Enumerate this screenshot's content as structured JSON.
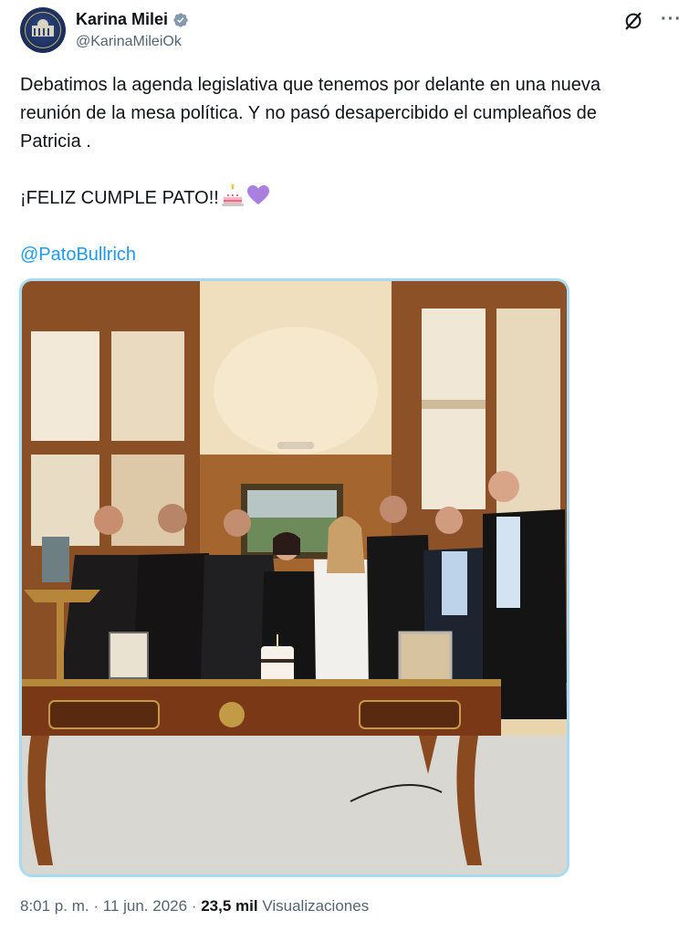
{
  "author": {
    "display_name": "Karina Milei",
    "handle": "@KarinaMileiOk",
    "verified": true,
    "avatar_icon": "government-seal-icon"
  },
  "actions": {
    "grok_icon": "grok-icon",
    "more_icon": "more-options-icon",
    "more_label": "···"
  },
  "tweet": {
    "line1": "Debatimos la agenda legislativa que tenemos por delante en una nueva",
    "line2": "reunión de la mesa política. Y no pasó desapercibido el cumpleaños de",
    "line3": "Patricia .",
    "celebration": "¡FELIZ CUMPLE PATO!!",
    "emojis": [
      "birthday-cake-icon",
      "purple-heart-icon"
    ],
    "mention": "@PatoBullrich"
  },
  "media": {
    "type": "photo",
    "subject": "group-photo-birthday-cake"
  },
  "meta": {
    "time": "8:01 p. m.",
    "separator": "·",
    "date": "11 jun. 2026",
    "views_count": "23,5 mil",
    "views_label": "Visualizaciones"
  },
  "colors": {
    "link": "#1d9bf0",
    "verified": "#829aab",
    "secondary_text": "#536471",
    "media_border": "#a8dbf3"
  }
}
